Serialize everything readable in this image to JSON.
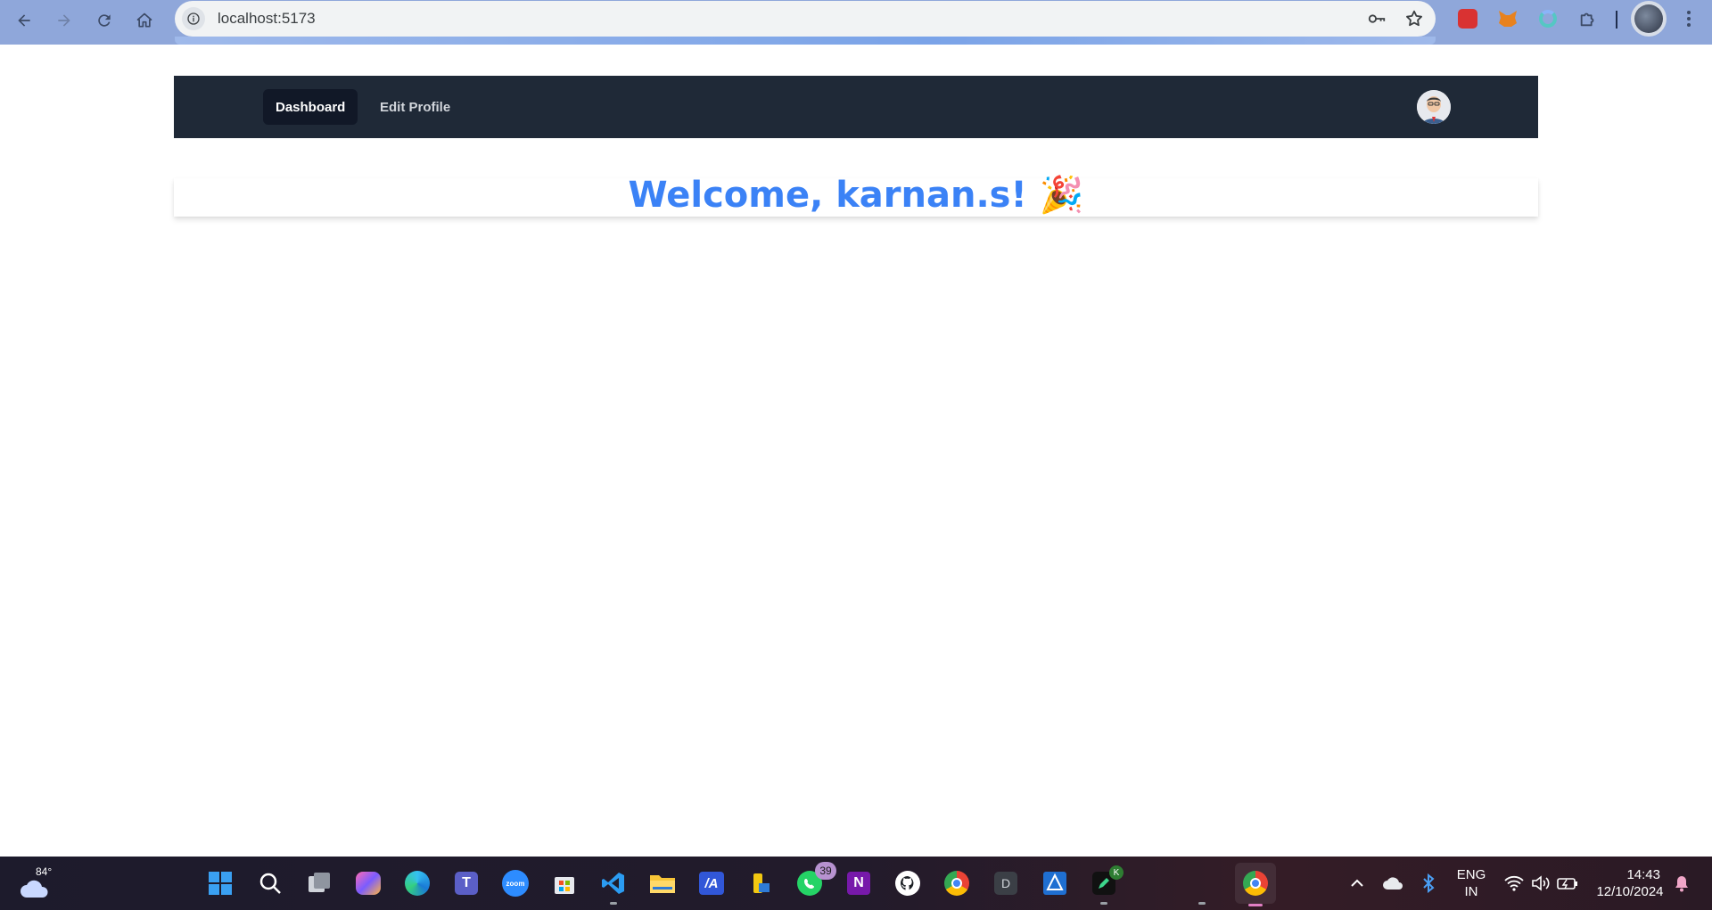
{
  "browser": {
    "url": "localhost:5173"
  },
  "nav": {
    "items": [
      {
        "label": "Dashboard",
        "active": true
      },
      {
        "label": "Edit Profile",
        "active": false
      }
    ]
  },
  "welcome": {
    "text": "Welcome, karnan.s! 🎉"
  },
  "taskbar": {
    "weather_temp": "84°",
    "whatsapp_badge": "39",
    "language_line1": "ENG",
    "language_line2": "IN",
    "time": "14:43",
    "date": "12/10/2024"
  },
  "colors": {
    "navbar_bg": "#1f2937",
    "nav_active_bg": "#111827",
    "welcome_text": "#3b82f6",
    "browser_frame": "#8fa7da"
  }
}
